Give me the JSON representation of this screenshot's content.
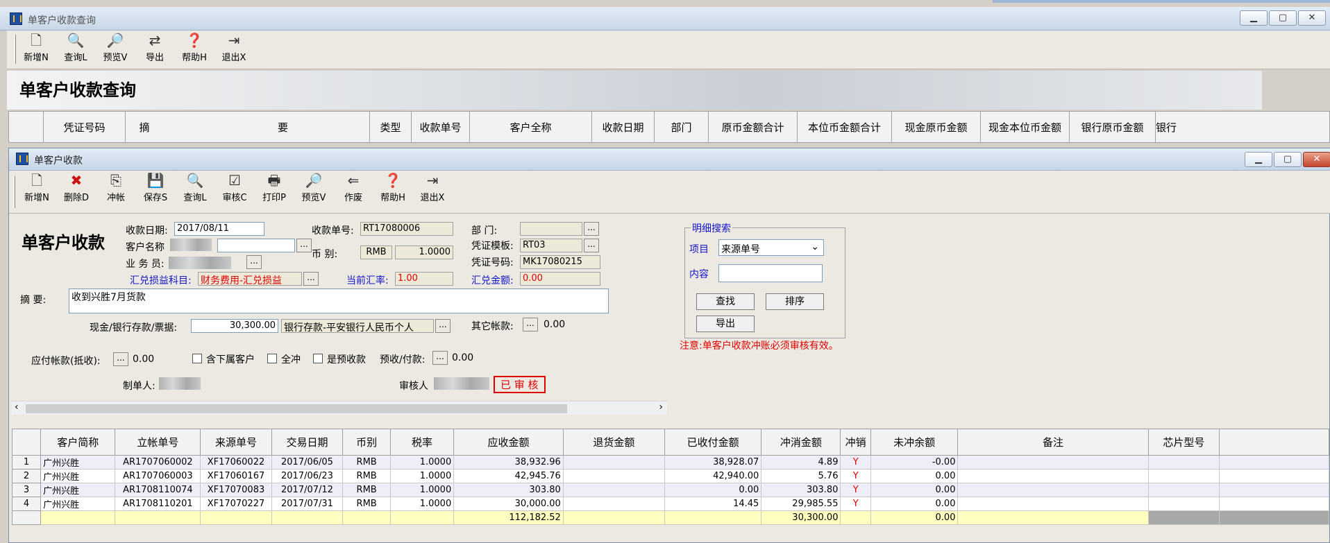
{
  "bg_window": {
    "title": "单客户收款查询",
    "toolbar": [
      {
        "icon": "new-doc-icon",
        "label": "新增N"
      },
      {
        "icon": "query-icon",
        "label": "查询L"
      },
      {
        "icon": "preview-icon",
        "label": "预览V"
      },
      {
        "icon": "export-icon",
        "label": "导出"
      },
      {
        "icon": "help-icon",
        "label": "帮助H"
      },
      {
        "icon": "exit-icon",
        "label": "退出X"
      }
    ],
    "banner_title": "单客户收款查询",
    "columns": [
      "凭证号码",
      "摘",
      "要",
      "类型",
      "收款单号",
      "客户全称",
      "收款日期",
      "部门",
      "原币金额合计",
      "本位币金额合计",
      "现金原币金额",
      "现金本位币金额",
      "银行原币金额",
      "银行"
    ]
  },
  "fg_window": {
    "title": "单客户收款",
    "toolbar": [
      {
        "icon": "new-doc-icon",
        "label": "新增N"
      },
      {
        "icon": "delete-icon",
        "label": "删除D"
      },
      {
        "icon": "offset-icon",
        "label": "冲帐"
      },
      {
        "icon": "save-icon",
        "label": "保存S"
      },
      {
        "icon": "query-icon",
        "label": "查询L"
      },
      {
        "icon": "audit-icon",
        "label": "审核C"
      },
      {
        "icon": "print-icon",
        "label": "打印P"
      },
      {
        "icon": "preview-icon",
        "label": "预览V"
      },
      {
        "icon": "void-icon",
        "label": "作废"
      },
      {
        "icon": "help-icon",
        "label": "帮助H"
      },
      {
        "icon": "exit-icon",
        "label": "退出X"
      }
    ],
    "form": {
      "heading": "单客户收款",
      "date_label": "收款日期:",
      "date_value": "2017/08/11",
      "customer_label": "客户名称",
      "salesman_label": "业 务 员:",
      "receipt_no_label": "收款单号:",
      "receipt_no_value": "RT17080006",
      "currency_label": "币 别:",
      "currency_value": "RMB",
      "currency_rate": "1.0000",
      "dept_label": "部 门:",
      "voucher_tpl_label": "凭证模板:",
      "voucher_tpl_value": "RT03",
      "voucher_no_label": "凭证号码:",
      "voucher_no_value": "MK17080215",
      "fx_subject_label": "汇兑损益科目:",
      "fx_subject_value": "财务费用-汇兑损益",
      "cur_rate_label": "当前汇率:",
      "cur_rate_value": "1.00",
      "fx_amount_label": "汇兑金额:",
      "fx_amount_value": "0.00",
      "summary_label": "摘 要:",
      "summary_value": "收到兴胜7月货款",
      "cash_label": "现金/银行存款/票据:",
      "cash_amount": "30,300.00",
      "cash_account": "银行存款-平安银行人民币个人",
      "other_label": "其它帐款:",
      "other_value": "0.00",
      "payable_label": "应付帐款(抵收):",
      "payable_value": "0.00",
      "chk_sub_customers": "含下属客户",
      "chk_full_offset": "全冲",
      "chk_prepaid": "是预收款",
      "prepaid_label": "预收/付款:",
      "prepaid_value": "0.00",
      "maker_label": "制单人:",
      "auditor_label": "审核人",
      "audited_stamp": "已 审 核"
    },
    "search": {
      "legend": "明细搜索",
      "item_label": "项目",
      "item_value": "来源单号",
      "content_label": "内容",
      "content_value": "",
      "find_btn": "查找",
      "sort_btn": "排序",
      "export_btn": "导出",
      "note": "注意:单客户收款冲账必须审核有效。"
    },
    "grid": {
      "columns": [
        "",
        "客户简称",
        "立帐单号",
        "来源单号",
        "交易日期",
        "币别",
        "税率",
        "应收金额",
        "退货金额",
        "已收付金额",
        "冲消金额",
        "冲销",
        "未冲余额",
        "备注",
        "芯片型号",
        ""
      ],
      "rows": [
        {
          "n": "1",
          "cust": "广州兴胜",
          "acct": "AR1707060002",
          "src": "XF17060022",
          "date": "2017/06/05",
          "cur": "RMB",
          "tax": "1.0000",
          "recv": "38,932.96",
          "ret": "",
          "paid": "38,928.07",
          "offset": "4.89",
          "flag": "Y",
          "remain": "-0.00",
          "memo": "",
          "chip": ""
        },
        {
          "n": "2",
          "cust": "广州兴胜",
          "acct": "AR1707060003",
          "src": "XF17060167",
          "date": "2017/06/23",
          "cur": "RMB",
          "tax": "1.0000",
          "recv": "42,945.76",
          "ret": "",
          "paid": "42,940.00",
          "offset": "5.76",
          "flag": "Y",
          "remain": "0.00",
          "memo": "",
          "chip": ""
        },
        {
          "n": "3",
          "cust": "广州兴胜",
          "acct": "AR1708110074",
          "src": "XF17070083",
          "date": "2017/07/12",
          "cur": "RMB",
          "tax": "1.0000",
          "recv": "303.80",
          "ret": "",
          "paid": "0.00",
          "offset": "303.80",
          "flag": "Y",
          "remain": "0.00",
          "memo": "",
          "chip": ""
        },
        {
          "n": "4",
          "cust": "广州兴胜",
          "acct": "AR1708110201",
          "src": "XF17070227",
          "date": "2017/07/31",
          "cur": "RMB",
          "tax": "1.0000",
          "recv": "30,000.00",
          "ret": "",
          "paid": "14.45",
          "offset": "29,985.55",
          "flag": "Y",
          "remain": "0.00",
          "memo": "",
          "chip": ""
        }
      ],
      "totals": {
        "recv": "112,182.52",
        "offset": "30,300.00",
        "remain": "0.00"
      }
    }
  },
  "colors": {
    "accent_red": "#e00000",
    "label_blue": "#1414c8",
    "total_row": "#ffffc0"
  }
}
